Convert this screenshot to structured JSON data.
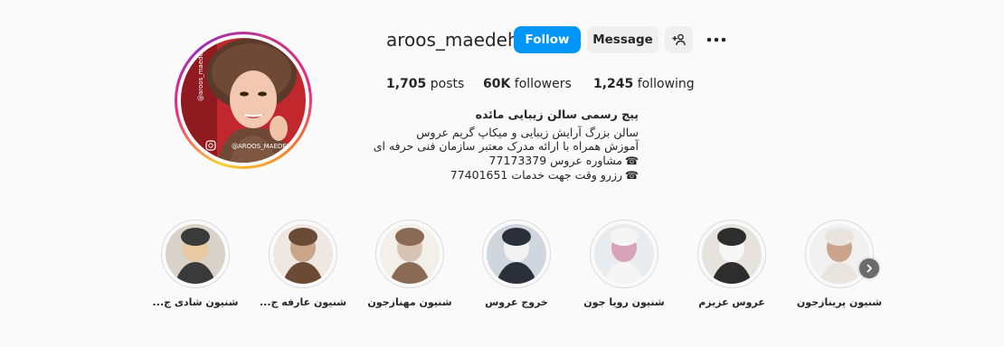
{
  "profile": {
    "username": "aroos_maedeh",
    "avatar_watermark": "@AROOS_MAEDEH"
  },
  "actions": {
    "follow_label": "Follow",
    "message_label": "Message",
    "add_user_icon": "person-add-icon",
    "more_icon": "more-horizontal-icon"
  },
  "stats": {
    "posts_count": "1,705",
    "posts_label": "posts",
    "followers_count": "60K",
    "followers_label": "followers",
    "following_count": "1,245",
    "following_label": "following"
  },
  "bio": {
    "full_name": "پیج رسمی سالن زیبایی مائده",
    "lines": [
      "سالن بزرگ آرایش زیبایی و میکاپ گریم عروس",
      "آموزش همراه با ارائه مدرک معتبر سازمان فنی حرفه ای",
      "مشاوره عروس 77173379",
      "رزرو وقت جهت خدمات 77401651"
    ],
    "phone_icon": "☎"
  },
  "highlights": [
    {
      "label": "شنیون شادی ج...",
      "colors": [
        "#d9d2c8",
        "#3a3a3a",
        "#e8c9a0"
      ]
    },
    {
      "label": "شنیون عارفه ج...",
      "colors": [
        "#efe8e2",
        "#6b4a36",
        "#c9a58a"
      ]
    },
    {
      "label": "شنیون مهنازجون",
      "colors": [
        "#f3efe9",
        "#8a6a55",
        "#d8c4b4"
      ]
    },
    {
      "label": "خروج عروس",
      "colors": [
        "#cfd6de",
        "#2b2f3a",
        "#f2f2f2"
      ]
    },
    {
      "label": "شنیون رویا جون",
      "colors": [
        "#e9ecef",
        "#f5f5f5",
        "#d9a3b7"
      ]
    },
    {
      "label": "عروس عزیزم",
      "colors": [
        "#e6e3df",
        "#2d2d2d",
        "#f7f7f7"
      ]
    },
    {
      "label": "شنیون پریناز‌جون",
      "colors": [
        "#f1f1f1",
        "#e9e4de",
        "#caa58b"
      ]
    }
  ],
  "highlights_next_icon": "chevron-right-icon"
}
